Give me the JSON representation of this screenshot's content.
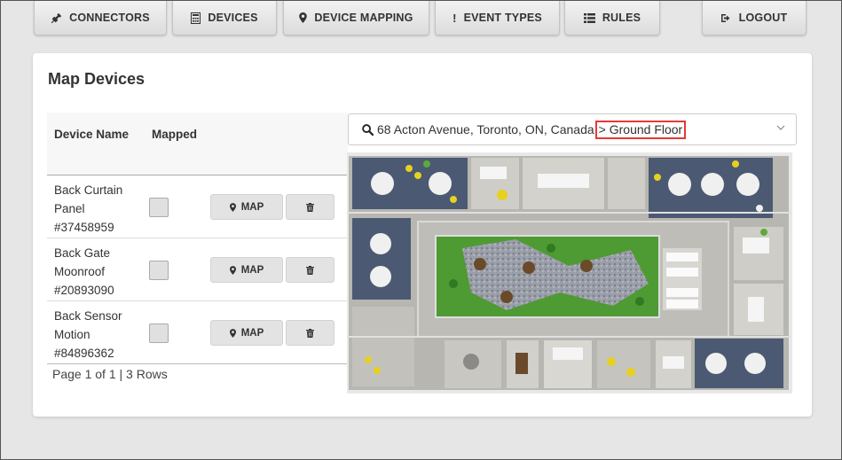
{
  "nav": {
    "connectors": "CONNECTORS",
    "devices": "DEVICES",
    "device_mapping": "DEVICE MAPPING",
    "event_types": "EVENT TYPES",
    "rules": "RULES",
    "logout": "LOGOUT"
  },
  "page": {
    "title": "Map Devices"
  },
  "table": {
    "headers": {
      "device_name": "Device Name",
      "mapped": "Mapped"
    },
    "rows": [
      {
        "name": "Back Curtain Panel #37458959",
        "mapped": false,
        "map_label": "MAP"
      },
      {
        "name": "Back Gate Moonroof #20893090",
        "mapped": false,
        "map_label": "MAP"
      },
      {
        "name": "Back Sensor Motion #84896362",
        "mapped": false,
        "map_label": "MAP"
      }
    ],
    "pager": "Page 1 of 1 | 3 Rows"
  },
  "location": {
    "address": "68 Acton Avenue, Toronto, ON, Canada",
    "floor": "> Ground Floor"
  },
  "colors": {
    "background": "#e6e6e6",
    "highlight": "#e53935",
    "office_floor": "#4b5a72",
    "garden": "#4e9a33"
  },
  "icons": [
    "plug-icon",
    "calculator-icon",
    "map-marker-icon",
    "exclamation-icon",
    "list-icon",
    "sign-out-icon",
    "search-icon",
    "chevron-down-icon",
    "trash-icon"
  ]
}
